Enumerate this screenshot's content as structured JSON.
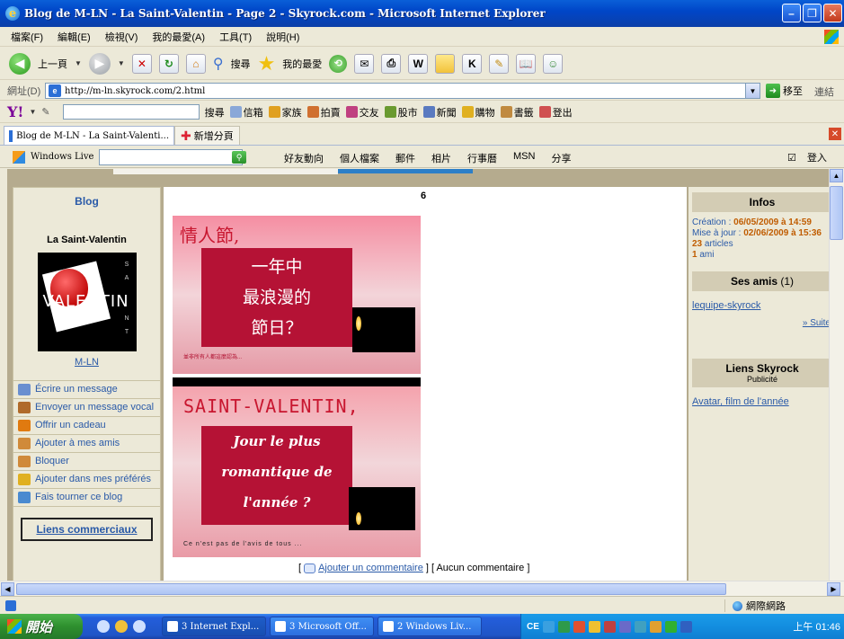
{
  "window": {
    "title": "Blog de M-LN - La Saint-Valentin - Page 2 - Skyrock.com - Microsoft Internet Explorer"
  },
  "menubar": [
    "檔案(F)",
    "編輯(E)",
    "檢視(V)",
    "我的最愛(A)",
    "工具(T)",
    "說明(H)"
  ],
  "toolbar": {
    "back": "上一頁",
    "search": "搜尋",
    "favorites": "我的最愛"
  },
  "address": {
    "label": "網址(D)",
    "url": "http://m-ln.skyrock.com/2.html",
    "go": "移至",
    "links": "連結"
  },
  "yahoo": {
    "search_btn": "搜尋",
    "items": [
      "信箱",
      "家族",
      "拍賣",
      "交友",
      "股市",
      "新聞",
      "購物",
      "書籤",
      "登出"
    ]
  },
  "tabs": {
    "active": "Blog de M-LN - La Saint-Valenti...",
    "new_tab": "新增分頁"
  },
  "live": {
    "brand": "Windows Live",
    "links": [
      "好友動向",
      "個人檔案",
      "郵件",
      "相片",
      "行事曆",
      "MSN",
      "分享"
    ],
    "signin": "登入"
  },
  "left": {
    "heading": "Blog",
    "blog_name": "La Saint-Valentin",
    "avatar_text": "VALENTIN",
    "author": "M-LN",
    "menu": [
      {
        "label": "Écrire un message",
        "color": "#6a8fd0"
      },
      {
        "label": "Envoyer un message vocal",
        "color": "#b06a2a"
      },
      {
        "label": "Offrir un cadeau",
        "color": "#e07a10"
      },
      {
        "label": "Ajouter à mes amis",
        "color": "#d08a3a"
      },
      {
        "label": "Bloquer",
        "color": "#d08a3a"
      },
      {
        "label": "Ajouter dans mes préférés",
        "color": "#e0b020"
      },
      {
        "label": "Fais tourner ce blog",
        "color": "#4a8ad0"
      }
    ],
    "liens_commerciaux": "Liens commerciaux"
  },
  "main": {
    "page_number": "6",
    "pic1": {
      "title": "情人節,",
      "lines": [
        "一年中",
        "最浪漫的",
        "節日？"
      ],
      "small": "並非所有人都這麼認為..."
    },
    "pic2": {
      "title": "SAINT-VALENTIN,",
      "lines": [
        "Jour le plus",
        "romantique de",
        "l'année ?"
      ],
      "small": "Ce n'est pas de l'avis de tous ..."
    },
    "comment_open": "[",
    "comment_link": "Ajouter un commentaire",
    "comment_rest": "] [ Aucun commentaire ]"
  },
  "right": {
    "infos_title": "Infos",
    "creation_label": "Création :",
    "creation_value": "06/05/2009 à 14:59",
    "maj_label": "Mise à jour :",
    "maj_value": "02/06/2009 à 15:36",
    "articles_count": "23",
    "articles_label": "articles",
    "ami_count": "1",
    "ami_label": "ami",
    "amis_title": "Ses amis",
    "amis_count": "(1)",
    "friend": "lequipe-skyrock",
    "suite": "» Suite",
    "liens_title": "Liens Skyrock",
    "liens_sub": "Publicité",
    "liens_link": "Avatar, film de l'année"
  },
  "status": {
    "zone": "網際網路"
  },
  "taskbar": {
    "start": "開始",
    "tasks": [
      "3 Internet Expl...",
      "3 Microsoft Off...",
      "2 Windows Liv..."
    ],
    "clock": "上午 01:46"
  }
}
